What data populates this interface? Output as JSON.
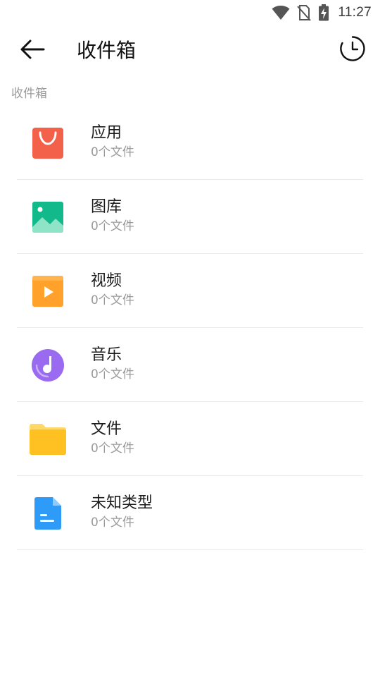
{
  "status_bar": {
    "time": "11:27",
    "icons": [
      "wifi-icon",
      "no-sim-icon",
      "battery-charging-icon"
    ]
  },
  "header": {
    "back_icon": "arrow-left-icon",
    "title": "收件箱",
    "history_icon": "clock-icon"
  },
  "section": {
    "label": "收件箱"
  },
  "items": [
    {
      "title": "应用",
      "subtitle": "0个文件",
      "icon": "shopping-bag-icon",
      "color": "#F4614A"
    },
    {
      "title": "图库",
      "subtitle": "0个文件",
      "icon": "image-icon",
      "color": "#12B98A"
    },
    {
      "title": "视频",
      "subtitle": "0个文件",
      "icon": "video-play-icon",
      "color": "#FFA12B"
    },
    {
      "title": "音乐",
      "subtitle": "0个文件",
      "icon": "music-disc-icon",
      "color": "#9A6AF0"
    },
    {
      "title": "文件",
      "subtitle": "0个文件",
      "icon": "folder-icon",
      "color": "#FFC021"
    },
    {
      "title": "未知类型",
      "subtitle": "0个文件",
      "icon": "document-icon",
      "color": "#2E9BF8"
    }
  ]
}
